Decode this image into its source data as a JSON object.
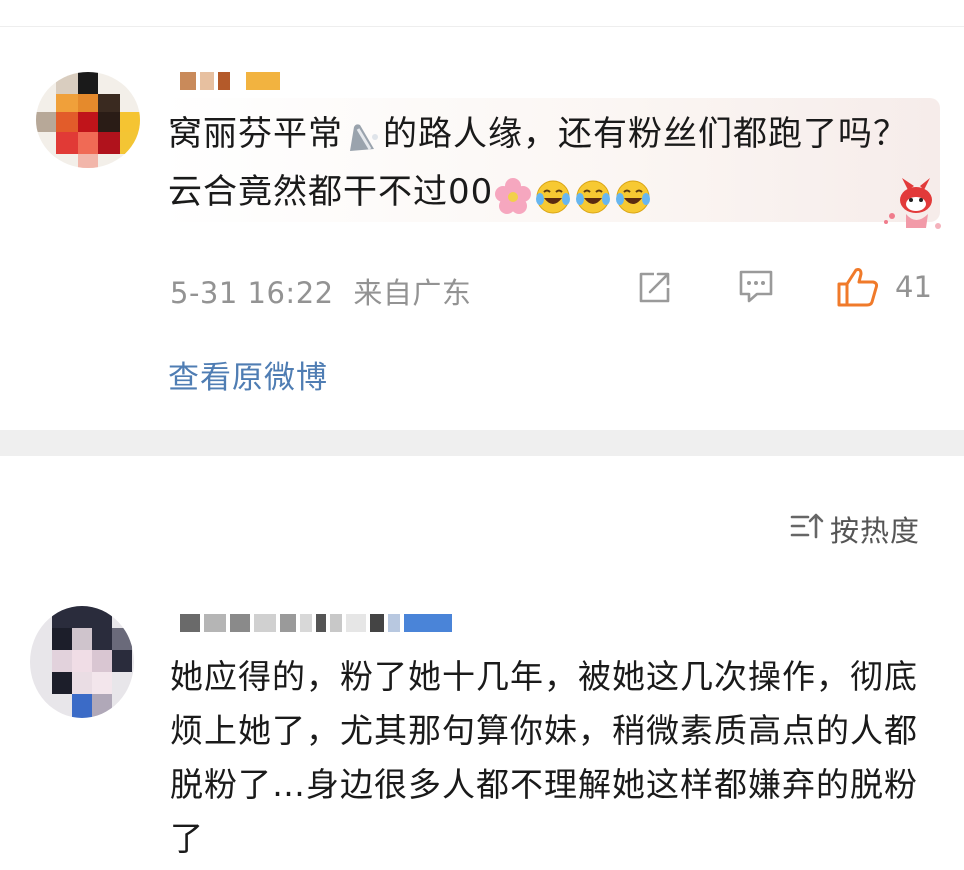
{
  "comments": [
    {
      "text_before_emoji": "窝丽芬平常",
      "text_middle": "的路人缘，还有粉丝们都跑了吗？云合竟然都干不过00",
      "emojis": [
        "ghost-emoji",
        "flower-emoji",
        "laughing-crying-emoji",
        "laughing-crying-emoji",
        "laughing-crying-emoji"
      ],
      "timestamp": "5-31 16:22",
      "location": "来自广东",
      "like_count": "41",
      "view_original_label": "查看原微博"
    },
    {
      "text": "她应得的，粉了她十几年，被她这几次操作，彻底烦上她了，尤其那句算你妹，稍微素质高点的人都脱粉了…身边很多人都不理解她这样都嫌弃的脱粉了"
    }
  ],
  "sort": {
    "label": "按热度",
    "icon": "sort-icon"
  },
  "colors": {
    "link": "#4f7db3",
    "meta": "#939393",
    "like_orange": "#f07a2a",
    "divider": "#efefef"
  }
}
